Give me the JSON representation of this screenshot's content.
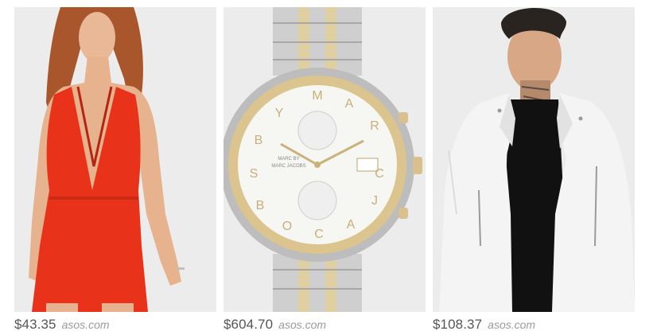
{
  "products": [
    {
      "price": "$43.35",
      "store": "asos.com",
      "image_alt": "red-halter-playsuit"
    },
    {
      "price": "$604.70",
      "store": "asos.com",
      "image_alt": "marc-by-marc-jacobs-watch"
    },
    {
      "price": "$108.37",
      "store": "asos.com",
      "image_alt": "white-biker-jacket"
    }
  ],
  "watch": {
    "brand_line1": "MARC BY",
    "brand_line2": "MARC JACOBS",
    "ring_letters": [
      "M",
      "A",
      "R",
      "C",
      "J",
      "A",
      "C",
      "O",
      "B",
      "S",
      "B",
      "Y"
    ]
  },
  "colors": {
    "dress": "#e8321a",
    "gold": "#d9c08c",
    "steel": "#c9c9c9",
    "jacket": "#f4f4f4",
    "card_bg": "#ececec",
    "price_text": "#555555",
    "store_text": "#9a9a9a"
  }
}
